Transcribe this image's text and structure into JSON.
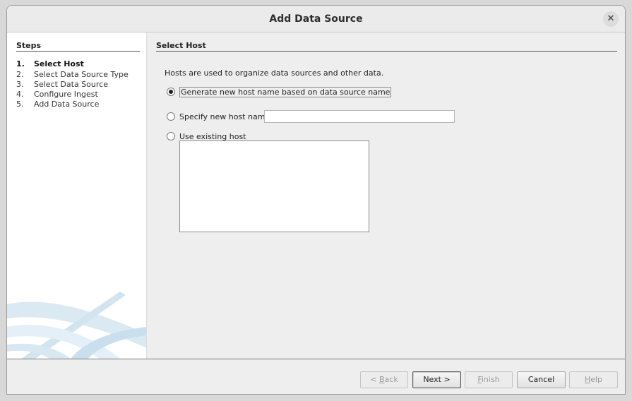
{
  "window": {
    "title": "Add Data Source"
  },
  "steps": {
    "heading": "Steps",
    "items": [
      {
        "num": "1.",
        "label": "Select Host",
        "current": true
      },
      {
        "num": "2.",
        "label": "Select Data Source Type",
        "current": false
      },
      {
        "num": "3.",
        "label": "Select Data Source",
        "current": false
      },
      {
        "num": "4.",
        "label": "Configure Ingest",
        "current": false
      },
      {
        "num": "5.",
        "label": "Add Data Source",
        "current": false
      }
    ]
  },
  "main": {
    "heading": "Select Host",
    "description": "Hosts are used to organize data sources and other data.",
    "options": [
      {
        "label": "Generate new host name based on data source name",
        "selected": true
      },
      {
        "label": "Specify new host name",
        "selected": false
      },
      {
        "label": "Use existing host",
        "selected": false
      }
    ],
    "host_name_value": "",
    "existing_hosts": []
  },
  "footer": {
    "back": {
      "pre": "< ",
      "mnemonic": "B",
      "post": "ack",
      "enabled": false
    },
    "next": {
      "label": "Next >",
      "enabled": true
    },
    "finish": {
      "mnemonic": "F",
      "post": "inish",
      "enabled": false
    },
    "cancel": {
      "label": "Cancel",
      "enabled": true
    },
    "help": {
      "mnemonic": "H",
      "post": "elp",
      "enabled": false
    }
  }
}
